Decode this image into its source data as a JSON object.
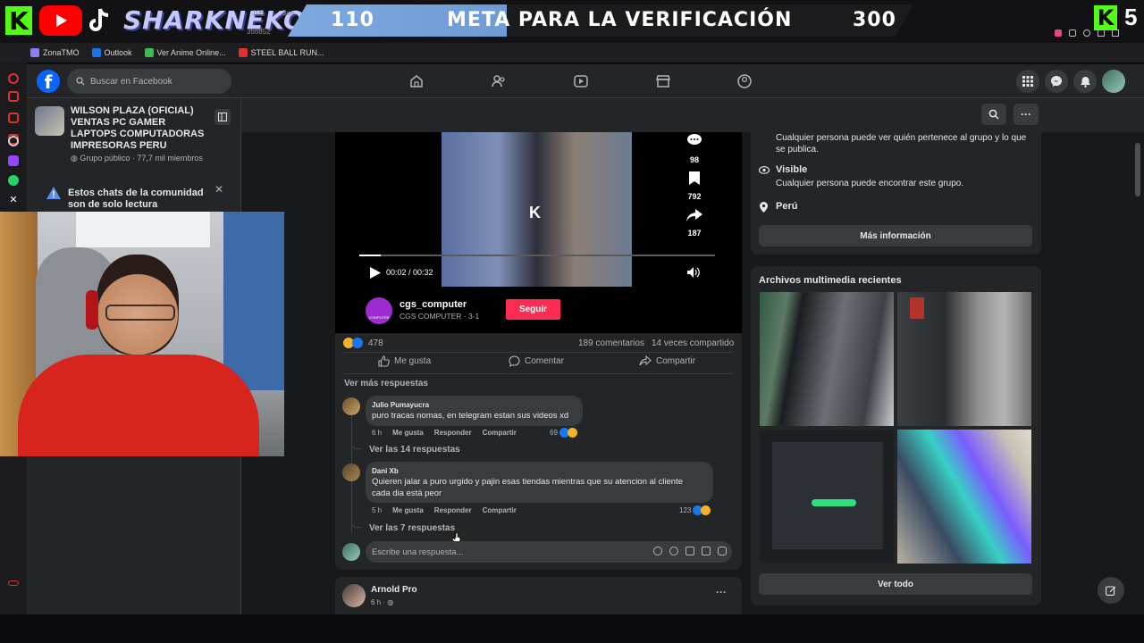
{
  "overlay": {
    "handle": "SHARKNEKO",
    "meta_current": "110",
    "meta_label": "META PARA LA VERIFICACIÓN",
    "meta_goal": "300",
    "k_logo_left": "K",
    "k_logo_right": "K",
    "count_right": "5",
    "behind_text_1": "105",
    "behind_text_2": "3ce",
    "behind_text_3": "356852"
  },
  "bookmarks": [
    {
      "label": "ZonaTMO",
      "color": "#8a7ef0"
    },
    {
      "label": "Outlook",
      "color": "#1a73e8"
    },
    {
      "label": "Ver Anime Online...",
      "color": "#3fb950"
    },
    {
      "label": "STEEL BALL RUN...",
      "color": "#e03131"
    }
  ],
  "topbar": {
    "logo": "f",
    "search_placeholder": "Buscar en Facebook"
  },
  "sidebar": {
    "group_name": "WILSON PLAZA (OFICIAL) VENTAS PC GAMER LAPTOPS COMPUTADORAS IMPRESORAS PERU",
    "group_meta": "Grupo público · 77,7 mil miembros",
    "chat_note": "Estos chats de la comunidad son de solo lectura"
  },
  "video": {
    "comments_count": "98",
    "saves_count": "792",
    "shares_count": "187",
    "time": "00:02 / 00:32",
    "watermark": "K",
    "channel_name": "cgs_computer",
    "channel_sub": "CGS COMPUTER · 3-1",
    "channel_badge": "COMPUTER",
    "follow_label": "Seguir",
    "progress": 0.06
  },
  "post": {
    "reactions_count": "478",
    "comments_label": "189 comentarios",
    "shares_label": "14 veces compartido",
    "like_label": "Me gusta",
    "comment_label": "Comentar",
    "share_label": "Compartir",
    "more_replies": "Ver más respuestas"
  },
  "comments": [
    {
      "name": "Julio Pumayucra",
      "text": "puro tracas nomas, en telegram estan sus videos xd",
      "time": "6 h",
      "like": "Me gusta",
      "reply": "Responder",
      "share": "Compartir",
      "reactions": "69",
      "view_replies": "Ver las 14 respuestas"
    },
    {
      "name": "Dani Xb",
      "text_line1": "Quieren jalar a puro urgido y pajin esas tiendas mientras que su atencion al cliente",
      "text_line2": "cada dia está peor",
      "time": "5 h",
      "like": "Me gusta",
      "reply": "Responder",
      "share": "Compartir",
      "reactions": "123",
      "view_replies": "Ver las 7 respuestas"
    }
  ],
  "reply_placeholder": "Escribe una respuesta...",
  "post2": {
    "author": "Arnold Pro",
    "time": "6 h ·"
  },
  "about": {
    "private_desc": "Cualquier persona puede ver quién pertenece al grupo y lo que se publica.",
    "visible_title": "Visible",
    "visible_desc": "Cualquier persona puede encontrar este grupo.",
    "location": "Perú",
    "more_info": "Más información"
  },
  "media": {
    "title": "Archivos multimedia recientes",
    "see_all": "Ver todo"
  },
  "icons": {
    "home": "home-icon",
    "friends": "friends-icon",
    "watch": "video-icon",
    "marketplace": "marketplace-icon",
    "groups": "groups-icon",
    "menu": "grid-icon",
    "messenger": "messenger-icon",
    "notifications": "bell-icon"
  },
  "colors": {
    "fb_blue": "#0866ff",
    "kick_green": "#53fc18",
    "follow_red": "#fe2c55",
    "card_bg": "#242526",
    "page_bg": "#18191a"
  }
}
